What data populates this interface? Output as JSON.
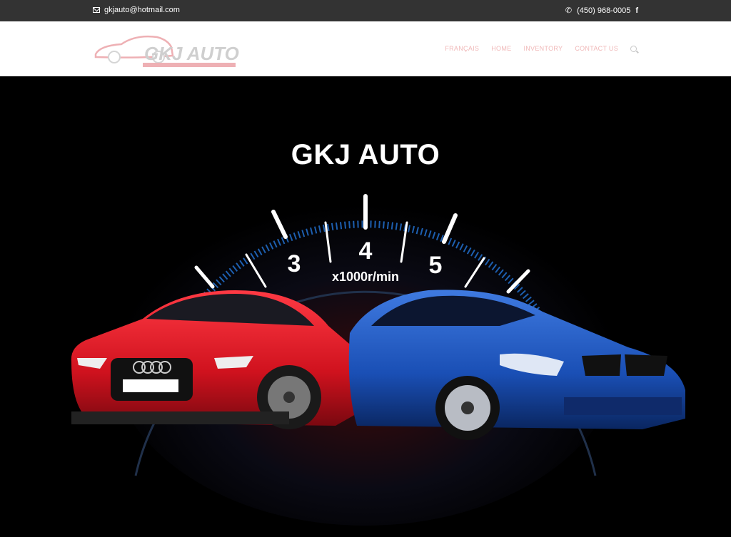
{
  "topbar": {
    "email": "gkjauto@hotmail.com",
    "phone": "(450) 968-0005",
    "facebook_label": "f"
  },
  "logo": {
    "text": "GKJ AUTO"
  },
  "nav": {
    "items": [
      "FRANÇAIS",
      "HOME",
      "INVENTORY",
      "CONTACT US"
    ]
  },
  "hero": {
    "title": "GKJ AUTO",
    "gauge_numbers": [
      "3",
      "4",
      "5"
    ],
    "gauge_unit": "x1000r/min"
  },
  "colors": {
    "topbar_bg": "#333333",
    "nav_text": "#f0b8b8",
    "red_car": "#d8182a",
    "blue_car": "#1a4fb5"
  }
}
